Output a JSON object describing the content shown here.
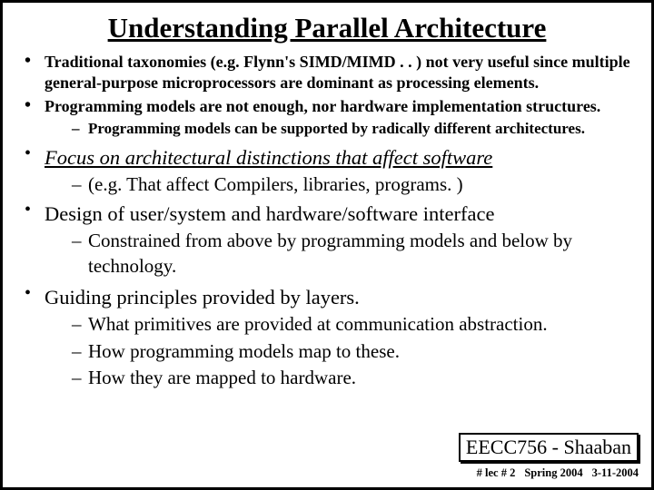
{
  "title": "Understanding Parallel Architecture",
  "bullets": {
    "b1": "Traditional taxonomies (e.g. Flynn's SIMD/MIMD . . ) not very useful since multiple general-purpose microprocessors are dominant as processing elements.",
    "b2": "Programming models are not enough, nor hardware implementation structures.",
    "b2s1": "Programming models can be supported by radically different architectures.",
    "b3": "Focus on architectural distinctions that affect software",
    "b3s1": "(e.g.  That affect Compilers, libraries, programs. )",
    "b4": "Design of user/system and hardware/software interface",
    "b4s1": "Constrained from above by programming models and below by technology.",
    "b5": "Guiding principles provided by layers.",
    "b5s1": "What primitives are provided at communication abstraction.",
    "b5s2": "How programming models map to these.",
    "b5s3": "How they are mapped to hardware."
  },
  "course": "EECC756 - Shaaban",
  "footer": {
    "slide": "#  lec # 2",
    "term": "Spring 2004",
    "date": "3-11-2004"
  }
}
